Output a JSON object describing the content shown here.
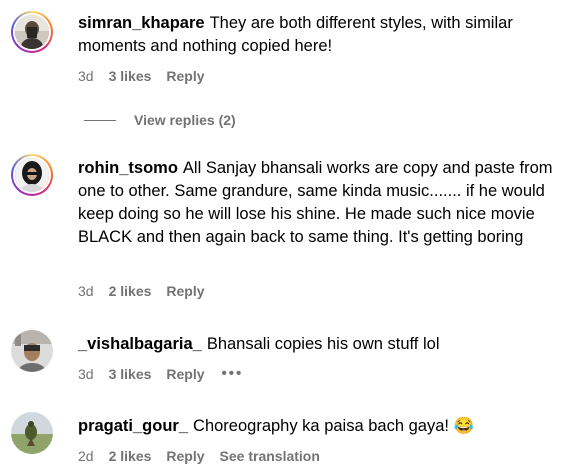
{
  "comments": [
    {
      "username": "simran_khapare",
      "text": "They are both different styles, with similar moments and nothing copied here!",
      "age": "3d",
      "likes": "3 likes",
      "reply": "Reply",
      "view_replies": "View replies (2)"
    },
    {
      "username": "rohin_tsomo",
      "text": "All Sanjay bhansali works are copy and paste from one to other. Same grandure, same kinda music....... if he would keep doing so he will lose his shine. He made such nice movie BLACK and then again back to same thing. It's getting boring",
      "age": "3d",
      "likes": "2 likes",
      "reply": "Reply"
    },
    {
      "username": "_vishalbagaria_",
      "text": "Bhansali copies his own stuff lol",
      "age": "3d",
      "likes": "3 likes",
      "reply": "Reply",
      "more": "•••"
    },
    {
      "username": "pragati_gour_",
      "text": "Choreography ka paisa bach gaya! 😂",
      "age": "2d",
      "likes": "2 likes",
      "reply": "Reply",
      "translation": "See translation"
    }
  ],
  "colors": {
    "secondary_text": "#737373",
    "story_ring": "gradient"
  }
}
